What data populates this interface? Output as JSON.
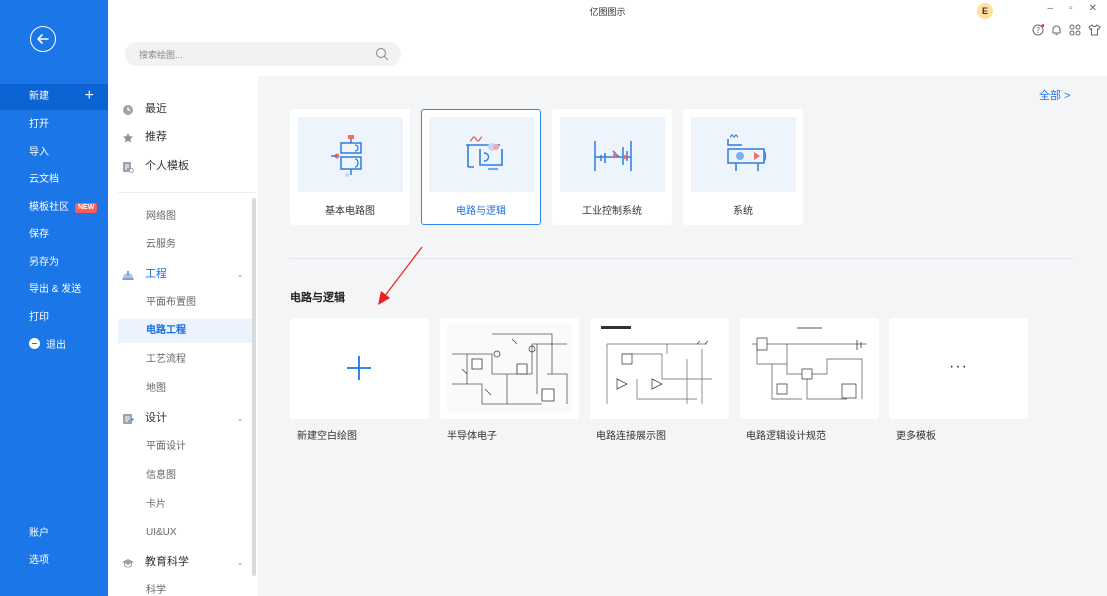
{
  "app": {
    "title": "亿图图示"
  },
  "header": {
    "user_initial": "E",
    "search_placeholder": "搜索绘图..."
  },
  "rail": {
    "items": [
      {
        "label": "新建",
        "name": "new"
      },
      {
        "label": "打开",
        "name": "open"
      },
      {
        "label": "导入",
        "name": "import"
      },
      {
        "label": "云文档",
        "name": "cloud-docs"
      },
      {
        "label": "模板社区",
        "name": "template-community",
        "badge": "NEW"
      },
      {
        "label": "保存",
        "name": "save"
      },
      {
        "label": "另存为",
        "name": "save-as"
      },
      {
        "label": "导出 & 发送",
        "name": "export-send"
      },
      {
        "label": "打印",
        "name": "print"
      },
      {
        "label": "退出",
        "name": "exit"
      }
    ],
    "bottom": [
      {
        "label": "账户",
        "name": "account"
      },
      {
        "label": "选项",
        "name": "options"
      }
    ]
  },
  "categories": {
    "top": [
      {
        "label": "最近",
        "icon": "clock-icon"
      },
      {
        "label": "推荐",
        "icon": "star-icon"
      },
      {
        "label": "个人模板",
        "icon": "personal-template-icon"
      }
    ],
    "items": [
      {
        "label": "网络图",
        "type": "sub"
      },
      {
        "label": "云服务",
        "type": "sub"
      },
      {
        "label": "工程",
        "type": "group",
        "icon": "engineering-icon"
      },
      {
        "label": "平面布置图",
        "type": "sub"
      },
      {
        "label": "电路工程",
        "type": "sub",
        "active": true
      },
      {
        "label": "工艺流程",
        "type": "sub"
      },
      {
        "label": "地图",
        "type": "sub"
      },
      {
        "label": "设计",
        "type": "group",
        "icon": "design-icon"
      },
      {
        "label": "平面设计",
        "type": "sub"
      },
      {
        "label": "信息图",
        "type": "sub"
      },
      {
        "label": "卡片",
        "type": "sub"
      },
      {
        "label": "UI&UX",
        "type": "sub"
      },
      {
        "label": "教育科学",
        "type": "group",
        "icon": "education-icon"
      },
      {
        "label": "科学",
        "type": "sub"
      }
    ]
  },
  "main": {
    "all_link": "全部 >",
    "types": [
      {
        "label": "基本电路图"
      },
      {
        "label": "电路与逻辑",
        "selected": true
      },
      {
        "label": "工业控制系统"
      },
      {
        "label": "系统"
      }
    ],
    "section_title": "电路与逻辑",
    "templates": [
      {
        "label": "新建空白绘图"
      },
      {
        "label": "半导体电子"
      },
      {
        "label": "电路连接展示图"
      },
      {
        "label": "电路逻辑设计规范"
      },
      {
        "label": "更多模板"
      }
    ]
  },
  "colors": {
    "rail": "#1b76e8",
    "accent": "#1b6fe0",
    "arrow": "#e8201e"
  }
}
